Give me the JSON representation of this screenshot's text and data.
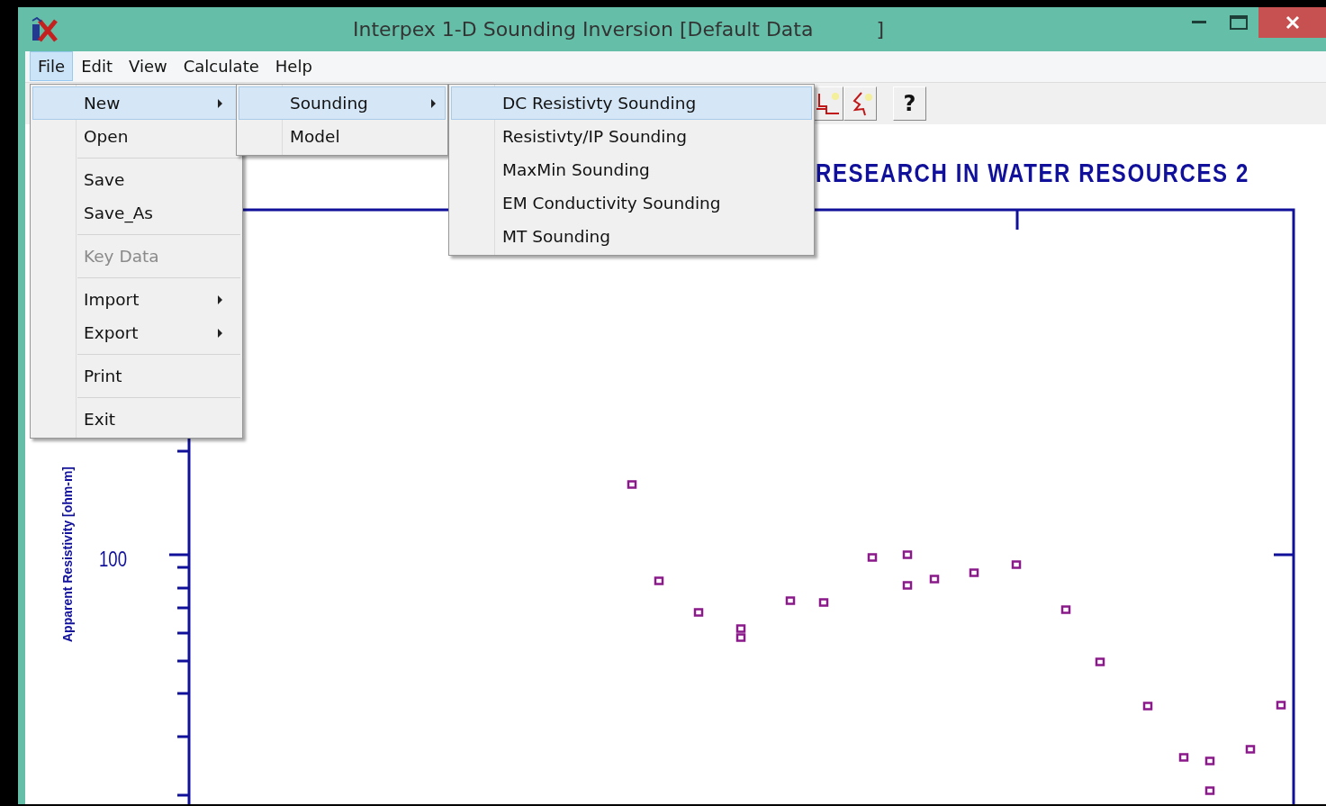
{
  "window": {
    "title": "Interpex 1-D Sounding Inversion [Default Data          ]"
  },
  "menu_bar": [
    {
      "label": "File",
      "selected": true
    },
    {
      "label": "Edit",
      "selected": false
    },
    {
      "label": "View",
      "selected": false
    },
    {
      "label": "Calculate",
      "selected": false
    },
    {
      "label": "Help",
      "selected": false
    }
  ],
  "toolbar": {
    "buttons": [
      {
        "kind": "steps"
      },
      {
        "kind": "curve"
      },
      {
        "kind": "help",
        "label": "?"
      }
    ]
  },
  "file_menu": {
    "items": [
      {
        "kind": "item",
        "label": "New",
        "submenu": true,
        "selected": true,
        "disabled": false
      },
      {
        "kind": "item",
        "label": "Open",
        "submenu": false,
        "selected": false,
        "disabled": false
      },
      {
        "kind": "separator"
      },
      {
        "kind": "item",
        "label": "Save",
        "submenu": false,
        "selected": false,
        "disabled": false
      },
      {
        "kind": "item",
        "label": "Save_As",
        "submenu": false,
        "selected": false,
        "disabled": false
      },
      {
        "kind": "separator"
      },
      {
        "kind": "item",
        "label": "Key Data",
        "submenu": false,
        "selected": false,
        "disabled": true
      },
      {
        "kind": "separator"
      },
      {
        "kind": "item",
        "label": "Import",
        "submenu": true,
        "selected": false,
        "disabled": false
      },
      {
        "kind": "item",
        "label": "Export",
        "submenu": true,
        "selected": false,
        "disabled": false
      },
      {
        "kind": "separator"
      },
      {
        "kind": "item",
        "label": "Print",
        "submenu": false,
        "selected": false,
        "disabled": false
      },
      {
        "kind": "separator"
      },
      {
        "kind": "item",
        "label": "Exit",
        "submenu": false,
        "selected": false,
        "disabled": false
      }
    ]
  },
  "new_menu": {
    "items": [
      {
        "kind": "item",
        "label": "Sounding",
        "submenu": true,
        "selected": true,
        "disabled": false
      },
      {
        "kind": "item",
        "label": "Model",
        "submenu": false,
        "selected": false,
        "disabled": false
      }
    ]
  },
  "sounding_menu": {
    "items": [
      {
        "kind": "item",
        "label": "DC Resistivty Sounding",
        "submenu": false,
        "selected": true,
        "disabled": false
      },
      {
        "kind": "item",
        "label": "Resistivty/IP Sounding",
        "submenu": false,
        "selected": false,
        "disabled": false
      },
      {
        "kind": "item",
        "label": "MaxMin Sounding",
        "submenu": false,
        "selected": false,
        "disabled": false
      },
      {
        "kind": "item",
        "label": "EM Conductivity Sounding",
        "submenu": false,
        "selected": false,
        "disabled": false
      },
      {
        "kind": "item",
        "label": "MT Sounding",
        "submenu": false,
        "selected": false,
        "disabled": false
      }
    ]
  },
  "chart": {
    "title": "RESEARCH IN WATER RESOURCES 2",
    "ylabel": "Apparent Resistivity [ohm-m]",
    "ytick_label": "100"
  }
}
